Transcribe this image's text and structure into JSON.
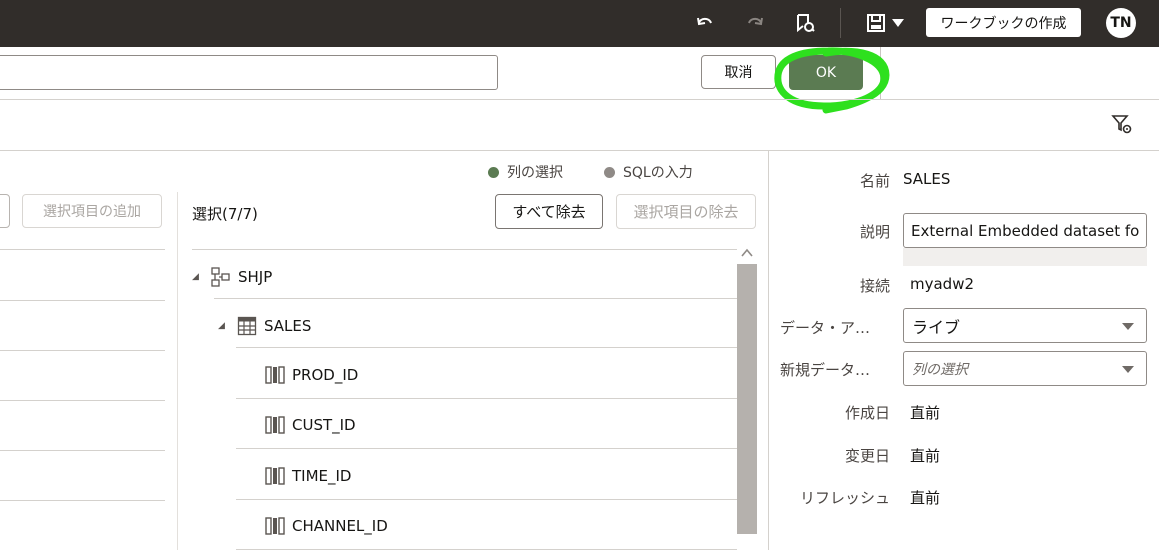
{
  "topbar": {
    "icons": [
      "undo-icon",
      "redo-icon",
      "bookmark-refresh-icon",
      "save-icon",
      "dropdown-arrow-icon"
    ],
    "create_workbook_label": "ワークブックの作成",
    "avatar_initials": "TN"
  },
  "actions": {
    "name_value": "",
    "cancel_label": "取消",
    "ok_label": "OK",
    "highlight_color": "#2ee01e"
  },
  "mode": {
    "columns_label": "列の選択",
    "columns_color": "#5b7b52",
    "sql_label": "SQLの入力",
    "sql_color": "#8f8a86"
  },
  "left_panel": {
    "add_selected_label": "選択項目の追加"
  },
  "selection": {
    "count_label": "選択(7/7)",
    "remove_all_label": "すべて除去",
    "remove_selected_label": "選択項目の除去",
    "tree": [
      {
        "label": "SHJP",
        "icon": "schema-icon",
        "level": 0,
        "expanded": true
      },
      {
        "label": "SALES",
        "icon": "table-icon",
        "level": 1,
        "expanded": true
      },
      {
        "label": "PROD_ID",
        "icon": "column-icon",
        "level": 2
      },
      {
        "label": "CUST_ID",
        "icon": "column-icon",
        "level": 2
      },
      {
        "label": "TIME_ID",
        "icon": "column-icon",
        "level": 2
      },
      {
        "label": "CHANNEL_ID",
        "icon": "column-icon",
        "level": 2
      }
    ]
  },
  "properties": {
    "name_label": "名前",
    "name_value": "SALES",
    "description_label": "説明",
    "description_value": "External Embedded dataset fo",
    "connection_label": "接続",
    "connection_value": "myadw2",
    "data_access_label": "データ・ア…",
    "data_access_value": "ライブ",
    "new_data_label": "新規データ…",
    "new_data_placeholder": "列の選択",
    "created_label": "作成日",
    "created_value": "直前",
    "modified_label": "変更日",
    "modified_value": "直前",
    "refresh_label": "リフレッシュ",
    "refresh_value": "直前"
  }
}
